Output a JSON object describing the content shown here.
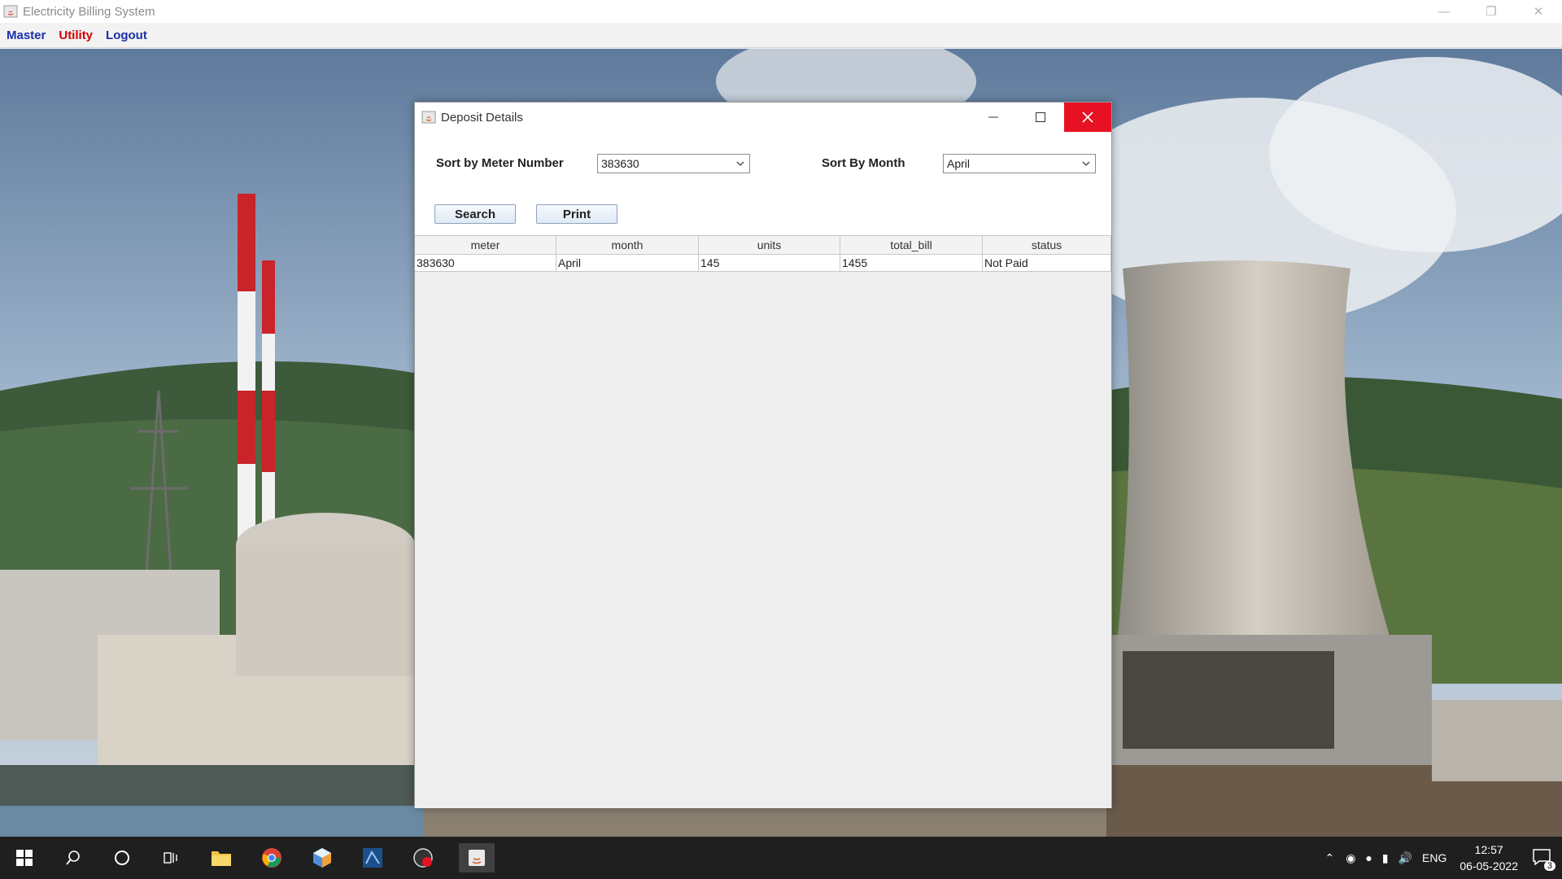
{
  "app": {
    "title": "Electricity Billing System",
    "menu": [
      {
        "label": "Master",
        "color": "#1a2fa8"
      },
      {
        "label": "Utility",
        "color": "#d00000"
      },
      {
        "label": "Logout",
        "color": "#1a2fa8"
      }
    ]
  },
  "dialog": {
    "title": "Deposit Details",
    "meter_label": "Sort by Meter Number",
    "meter_value": "383630",
    "month_label": "Sort By Month",
    "month_value": "April",
    "search_button": "Search",
    "print_button": "Print",
    "table": {
      "columns": [
        "meter",
        "month",
        "units",
        "total_bill",
        "status"
      ],
      "rows": [
        [
          "383630",
          "April",
          "145",
          "1455",
          "Not Paid"
        ]
      ]
    }
  },
  "taskbar": {
    "language": "ENG",
    "time": "12:57",
    "date": "06-05-2022",
    "notifications": "3"
  },
  "colors": {
    "close_red": "#e81123",
    "taskbar": "#1f1f1f"
  }
}
